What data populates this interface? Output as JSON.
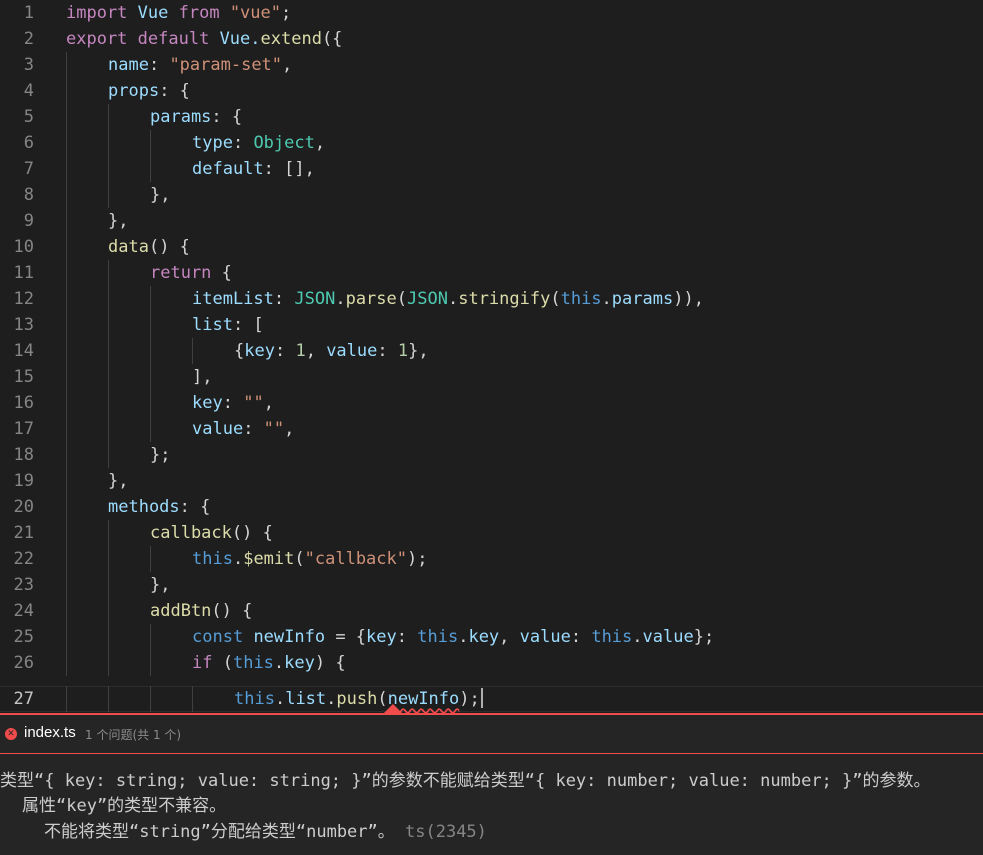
{
  "editor": {
    "line_numbers": [
      "1",
      "2",
      "3",
      "4",
      "5",
      "6",
      "7",
      "8",
      "9",
      "10",
      "11",
      "12",
      "13",
      "14",
      "15",
      "16",
      "17",
      "18",
      "19",
      "20",
      "21",
      "22",
      "23",
      "24",
      "25",
      "26",
      "27"
    ],
    "current_line": "27",
    "lines": {
      "l1": {
        "t0": "import",
        "t1": " Vue ",
        "t2": "from",
        "t3": " ",
        "t4": "\"vue\"",
        "t5": ";"
      },
      "l2": {
        "t0": "export",
        "t1": " ",
        "t2": "default",
        "t3": " Vue.",
        "t4": "extend",
        "t5": "({"
      },
      "l3": {
        "t0": "name",
        "t1": ": ",
        "t2": "\"param-set\"",
        "t3": ","
      },
      "l4": {
        "t0": "props",
        "t1": ": {"
      },
      "l5": {
        "t0": "params",
        "t1": ": {"
      },
      "l6": {
        "t0": "type",
        "t1": ": ",
        "t2": "Object",
        "t3": ","
      },
      "l7": {
        "t0": "default",
        "t1": ": [],"
      },
      "l8": {
        "t0": "},"
      },
      "l9": {
        "t0": "},"
      },
      "l10": {
        "t0": "data",
        "t1": "() {"
      },
      "l11": {
        "t0": "return",
        "t1": " {"
      },
      "l12": {
        "t0": "itemList",
        "t1": ": ",
        "t2": "JSON",
        "t3": ".",
        "t4": "parse",
        "t5": "(",
        "t6": "JSON",
        "t7": ".",
        "t8": "stringify",
        "t9": "(",
        "t10": "this",
        "t11": ".",
        "t12": "params",
        "t13": ")),"
      },
      "l13": {
        "t0": "list",
        "t1": ": ["
      },
      "l14": {
        "t0": "{",
        "t1": "key",
        "t2": ": ",
        "t3": "1",
        "t4": ", ",
        "t5": "value",
        "t6": ": ",
        "t7": "1",
        "t8": "},"
      },
      "l15": {
        "t0": "],"
      },
      "l16": {
        "t0": "key",
        "t1": ": ",
        "t2": "\"\"",
        "t3": ","
      },
      "l17": {
        "t0": "value",
        "t1": ": ",
        "t2": "\"\"",
        "t3": ","
      },
      "l18": {
        "t0": "};"
      },
      "l19": {
        "t0": "},"
      },
      "l20": {
        "t0": "methods",
        "t1": ": {"
      },
      "l21": {
        "t0": "callback",
        "t1": "() {"
      },
      "l22": {
        "t0": "this",
        "t1": ".",
        "t2": "$emit",
        "t3": "(",
        "t4": "\"callback\"",
        "t5": ");"
      },
      "l23": {
        "t0": "},"
      },
      "l24": {
        "t0": "addBtn",
        "t1": "() {"
      },
      "l25": {
        "t0": "const",
        "t1": " ",
        "t2": "newInfo",
        "t3": " = {",
        "t4": "key",
        "t5": ": ",
        "t6": "this",
        "t7": ".",
        "t8": "key",
        "t9": ", ",
        "t10": "value",
        "t11": ": ",
        "t12": "this",
        "t13": ".",
        "t14": "value",
        "t15": "};"
      },
      "l26": {
        "t0": "if",
        "t1": " (",
        "t2": "this",
        "t3": ".",
        "t4": "key",
        "t5": ") {"
      },
      "l27": {
        "t0": "this",
        "t1": ".",
        "t2": "list",
        "t3": ".",
        "t4": "push",
        "t5": "(",
        "t6": "newInfo",
        "t7": ");"
      }
    }
  },
  "problem_peek": {
    "file_name": "index.ts",
    "count_text": "1 个问题(共 1 个)",
    "message_line1": "类型“{ key: string; value: string; }”的参数不能赋给类型“{ key: number; value: number; }”的参数。",
    "message_line2": "属性“key”的类型不兼容。",
    "message_line3": "不能将类型“string”分配给类型“number”。",
    "error_code": "ts(2345)"
  },
  "colors": {
    "background": "#1e1e1e",
    "keyword": "#569cd6",
    "control": "#c586c0",
    "string": "#ce9178",
    "variable": "#9cdcfe",
    "function": "#dcdcaa",
    "type": "#4ec9b0",
    "number": "#b5cea8",
    "error": "#f14c4c"
  }
}
